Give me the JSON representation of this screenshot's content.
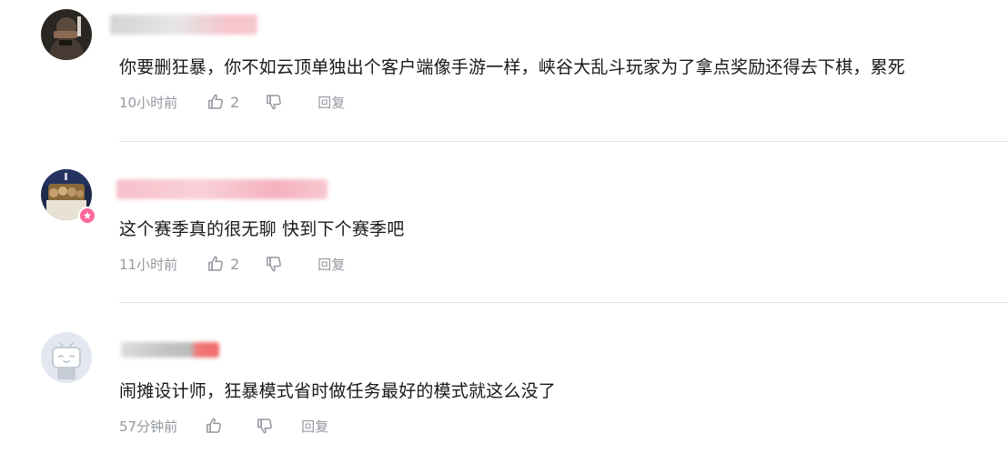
{
  "comments": [
    {
      "content": "你要删狂暴，你不如云顶单独出个客户端像手游一样，峡谷大乱斗玩家为了拿点奖励还得去下棋，累死",
      "time": "10小时前",
      "likes": "2",
      "reply_label": "回复",
      "avatar_icon": "avatar-dark-figure-icon",
      "has_badge": false
    },
    {
      "content": "这个赛季真的很无聊 快到下个赛季吧",
      "time": "11小时前",
      "likes": "2",
      "reply_label": "回复",
      "avatar_icon": "avatar-crowd-photo-icon",
      "has_badge": true
    },
    {
      "content": "闹摊设计师，狂暴模式省时做任务最好的模式就这么没了",
      "time": "57分钟前",
      "likes": "",
      "reply_label": "回复",
      "avatar_icon": "avatar-default-tv-icon",
      "has_badge": false
    }
  ],
  "colors": {
    "text": "#18191c",
    "meta": "#9499a0",
    "divider": "#e3e5e7",
    "badge": "#ff6699",
    "username_blur_primary": "#f4a8b8",
    "username_blur_gray": "#c8c8c8"
  }
}
